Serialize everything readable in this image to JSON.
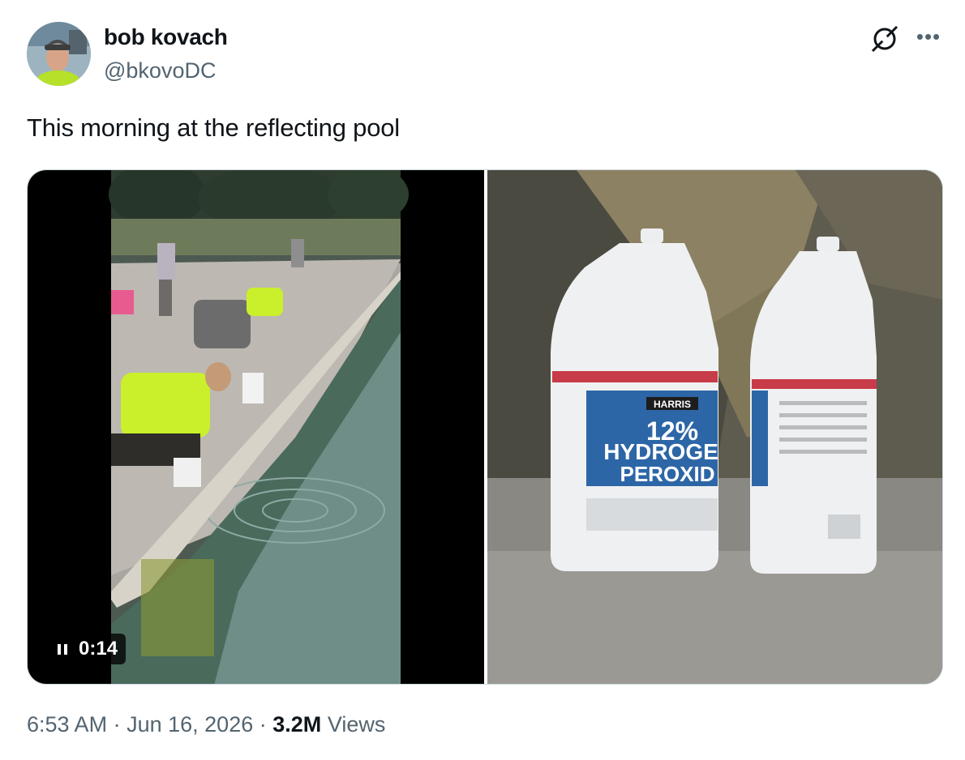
{
  "author": {
    "display_name": "bob kovach",
    "handle": "@bkovoDC"
  },
  "tweet": {
    "text": "This morning at the reflecting pool"
  },
  "video": {
    "duration": "0:14"
  },
  "photo": {
    "label_brand": "HARRIS",
    "label_line1": "12%",
    "label_line2": "HYDROGE",
    "label_line3": "PEROXID"
  },
  "meta": {
    "time": "6:53 AM",
    "sep1": "·",
    "date": "Jun 16, 2026",
    "sep2": "·",
    "views_count": "3.2M",
    "views_label": "Views"
  },
  "icons": {
    "grok": "grok-icon",
    "more": "more-icon",
    "pause": "pause-icon"
  },
  "colors": {
    "text": "#0f1419",
    "secondary": "#536471",
    "border": "#cfd9de"
  }
}
